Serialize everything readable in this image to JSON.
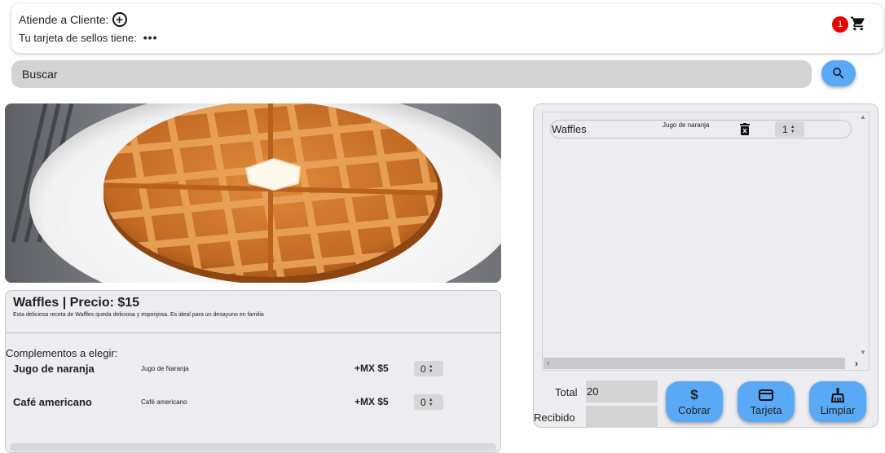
{
  "header": {
    "attend_label": "Atiende a Cliente:",
    "stamps_label": "Tu tarjeta de sellos tiene:",
    "stamps_more": "•••",
    "cart_count": "1"
  },
  "search": {
    "placeholder": "Buscar"
  },
  "product": {
    "title": "Waffles | Precio: $15",
    "description": "Esta deliciosa receta de Waffles queda deliciosa y esponjosa. Es ideal para un desayuno en familia",
    "complements_title": "Complementos a elegir:",
    "complements": [
      {
        "name": "Jugo de naranja",
        "desc": "Jugo de Naranja",
        "price": "+MX $5",
        "qty": "0"
      },
      {
        "name": "Café americano",
        "desc": "Café americano",
        "price": "+MX $5",
        "qty": "0"
      }
    ]
  },
  "order": {
    "items": [
      {
        "name": "Waffles",
        "complement": "Jugo de naranja",
        "qty": "1"
      }
    ],
    "total_label": "Total",
    "total_value": "20",
    "received_label": "Recibido",
    "received_value": "",
    "buttons": {
      "charge": "Cobrar",
      "card": "Tarjeta",
      "clear": "Limpiar"
    }
  },
  "colors": {
    "accent": "#5aa9f7",
    "badge": "#e60000",
    "field": "#d3d3d3"
  }
}
